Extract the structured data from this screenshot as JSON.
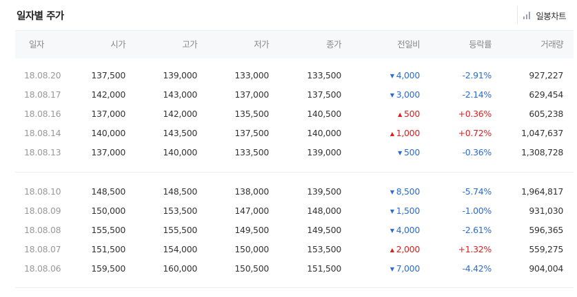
{
  "header": {
    "title": "일자별 주가",
    "chart_button_label": "일봉차트",
    "chart_button_icon": "bar-chart-icon"
  },
  "columns": [
    "일자",
    "시가",
    "고가",
    "저가",
    "종가",
    "전일비",
    "등락률",
    "거래량"
  ],
  "colors": {
    "down": "#2a6bd6",
    "up": "#e21c1c"
  },
  "groups": [
    [
      {
        "date": "18.08.20",
        "open": "137,500",
        "high": "139,000",
        "low": "133,000",
        "close": "133,500",
        "dir": "down",
        "change": "4,000",
        "rate": "-2.91%",
        "volume": "927,227"
      },
      {
        "date": "18.08.17",
        "open": "142,000",
        "high": "143,000",
        "low": "137,000",
        "close": "137,500",
        "dir": "down",
        "change": "3,000",
        "rate": "-2.14%",
        "volume": "629,454"
      },
      {
        "date": "18.08.16",
        "open": "137,000",
        "high": "142,000",
        "low": "135,500",
        "close": "140,500",
        "dir": "up",
        "change": "500",
        "rate": "+0.36%",
        "volume": "605,238"
      },
      {
        "date": "18.08.14",
        "open": "140,000",
        "high": "143,500",
        "low": "137,500",
        "close": "140,000",
        "dir": "up",
        "change": "1,000",
        "rate": "+0.72%",
        "volume": "1,047,637"
      },
      {
        "date": "18.08.13",
        "open": "137,000",
        "high": "140,000",
        "low": "133,500",
        "close": "139,000",
        "dir": "down",
        "change": "500",
        "rate": "-0.36%",
        "volume": "1,308,728"
      }
    ],
    [
      {
        "date": "18.08.10",
        "open": "148,500",
        "high": "148,500",
        "low": "138,000",
        "close": "139,500",
        "dir": "down",
        "change": "8,500",
        "rate": "-5.74%",
        "volume": "1,964,817"
      },
      {
        "date": "18.08.09",
        "open": "150,000",
        "high": "153,500",
        "low": "147,000",
        "close": "148,000",
        "dir": "down",
        "change": "1,500",
        "rate": "-1.00%",
        "volume": "931,030"
      },
      {
        "date": "18.08.08",
        "open": "155,500",
        "high": "155,500",
        "low": "149,500",
        "close": "149,500",
        "dir": "down",
        "change": "4,000",
        "rate": "-2.61%",
        "volume": "596,365"
      },
      {
        "date": "18.08.07",
        "open": "151,500",
        "high": "154,000",
        "low": "150,000",
        "close": "153,500",
        "dir": "up",
        "change": "2,000",
        "rate": "+1.32%",
        "volume": "559,275"
      },
      {
        "date": "18.08.06",
        "open": "159,500",
        "high": "160,000",
        "low": "150,500",
        "close": "151,500",
        "dir": "down",
        "change": "7,000",
        "rate": "-4.42%",
        "volume": "904,004"
      }
    ]
  ]
}
